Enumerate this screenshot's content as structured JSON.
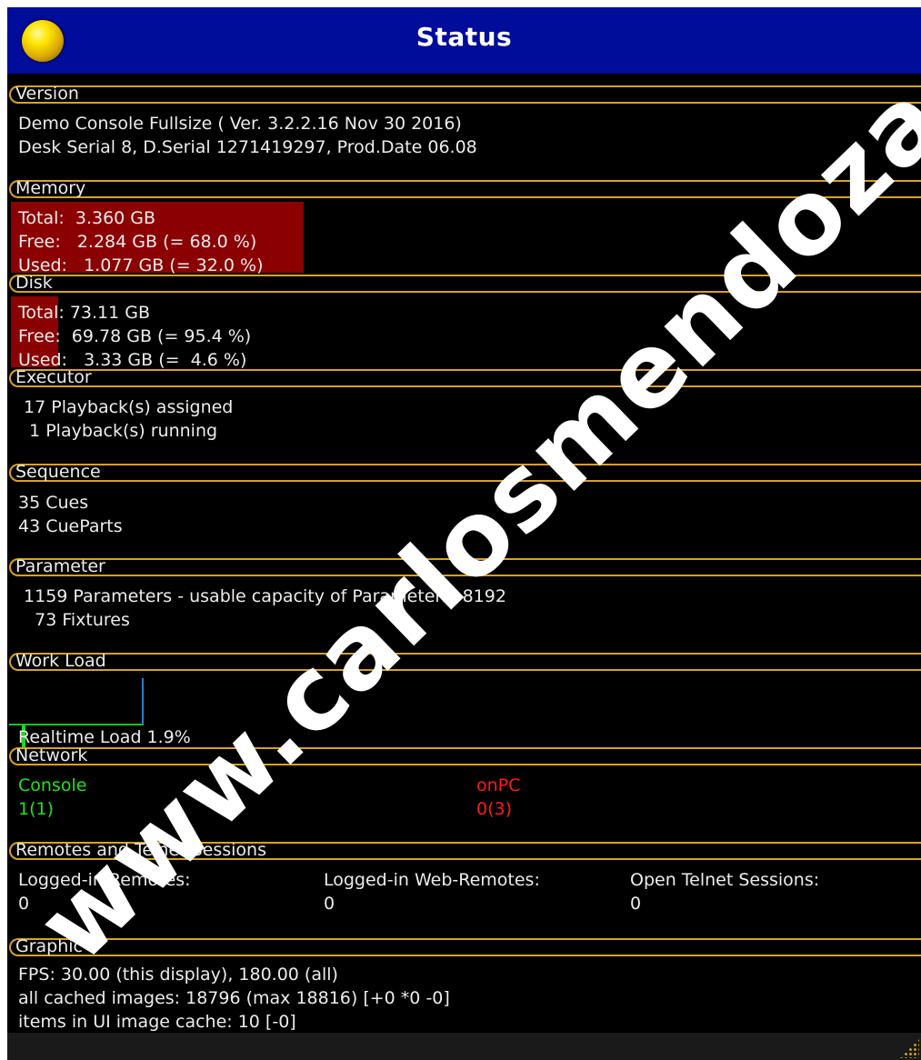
{
  "window": {
    "title": "Status"
  },
  "sections": {
    "version": {
      "header": "Version",
      "lines": [
        "Demo Console Fullsize ( Ver. 3.2.2.16 Nov 30 2016)",
        "Desk Serial 8, D.Serial 1271419297, Prod.Date 06.08"
      ]
    },
    "memory": {
      "header": "Memory",
      "lines": [
        "Total:  3.360 GB",
        "Free:   2.284 GB (= 68.0 %)",
        "Used:   1.077 GB (= 32.0 %)"
      ],
      "used_fraction": 0.32
    },
    "disk": {
      "header": "Disk",
      "lines": [
        "Total: 73.11 GB",
        "Free:  69.78 GB (= 95.4 %)",
        "Used:   3.33 GB (=  4.6 %)"
      ],
      "used_fraction": 0.046
    },
    "executor": {
      "header": "Executor",
      "lines": [
        " 17 Playback(s) assigned",
        "  1 Playback(s) running"
      ]
    },
    "sequence": {
      "header": "Sequence",
      "lines": [
        "35 Cues",
        "43 CueParts"
      ]
    },
    "parameter": {
      "header": "Parameter",
      "lines": [
        " 1159 Parameters - usable capacity of Parameters: 8192",
        "   73 Fixtures"
      ]
    },
    "workload": {
      "header": "Work Load",
      "realtime_label": "Realtime Load 1.9%",
      "realtime_load_percent": 1.9
    },
    "network": {
      "header": "Network",
      "console_label": "Console",
      "console_value": "1(1)",
      "onpc_label": "onPC",
      "onpc_value": "0(3)",
      "console_color": "#1ee31e",
      "onpc_color": "#ff1a1a"
    },
    "remotes": {
      "header": "Remotes and Telnet Sessions",
      "col1_label": "Logged-in Remotes:",
      "col1_value": "0",
      "col2_label": "Logged-in Web-Remotes:",
      "col2_value": "0",
      "col3_label": "Open Telnet Sessions:",
      "col3_value": "0"
    },
    "graphic": {
      "header": "Graphic",
      "lines": [
        "FPS: 30.00 (this display), 180.00 (all)",
        "all cached images: 18796 (max 18816) [+0 *0 -0]",
        "items in UI image cache: 10 [-0]"
      ]
    }
  },
  "watermark": "www.carlosmendoza.com",
  "colors": {
    "title_bar": "#000c9a",
    "section_border": "#d8a127",
    "memory_bar": "#8b0000"
  }
}
